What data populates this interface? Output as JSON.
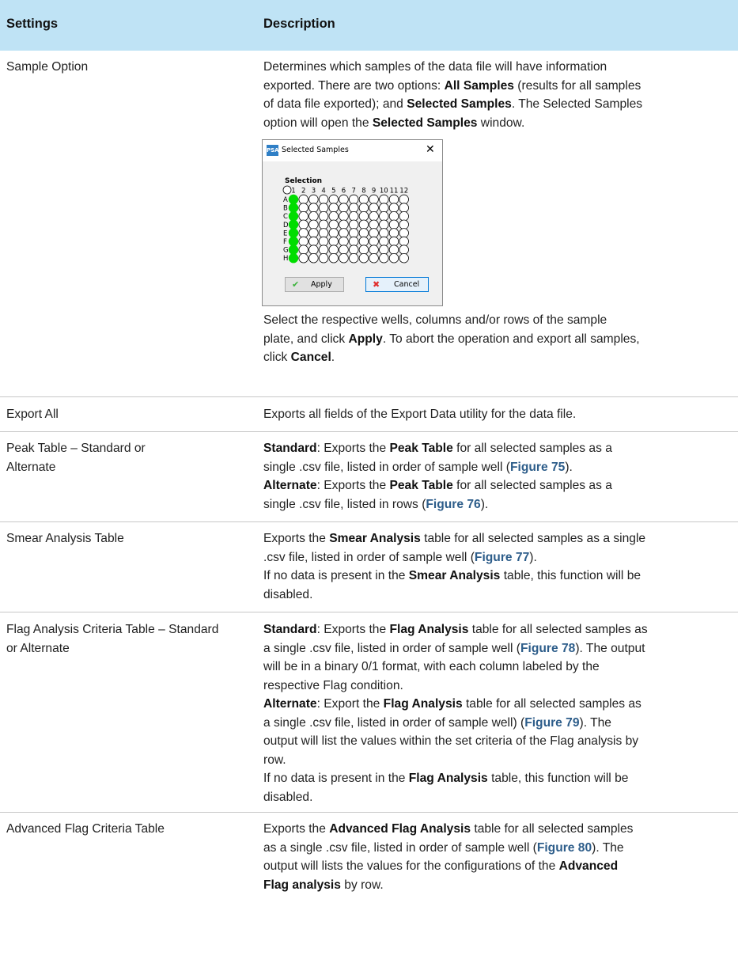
{
  "header": {
    "settings": "Settings",
    "description": "Description"
  },
  "rows": [
    {
      "setting": "Sample Option",
      "lines": [
        [
          "Determines which samples of the data file will have information"
        ],
        [
          "exported. There are two options: ",
          "<b>All Samples</b>",
          " (results for all samples"
        ],
        [
          "of data file exported); and ",
          "<b>Selected Samples</b>",
          ". The Selected Samples"
        ],
        [
          "option will open the ",
          "<b>Selected Samples</b>",
          " window."
        ]
      ],
      "after_lines": [
        [
          "Select the respective wells, columns and/or rows of the sample"
        ],
        [
          "plate, and click ",
          "<b>Apply</b>",
          ". To abort the operation and export all samples,"
        ],
        [
          "click ",
          "<b>Cancel</b>",
          "."
        ]
      ]
    },
    {
      "setting": "Export All",
      "lines": [
        [
          "Exports all fields of the Export Data utility for the data file."
        ]
      ]
    },
    {
      "setting": "Peak Table – Standard or Alternate",
      "lines": [
        [
          "<b>Standard</b>",
          ": Exports the ",
          "<b>Peak Table</b>",
          " for all selected samples as a"
        ],
        [
          "single .csv file, listed in order of sample well (",
          "<l>Figure 75</l>",
          ")."
        ],
        [
          "<b>Alternate</b>",
          ": Exports the ",
          "<b>Peak Table</b>",
          " for all selected samples as a"
        ],
        [
          "single .csv file, listed in rows (",
          "<l>Figure 76</l>",
          ")."
        ]
      ]
    },
    {
      "setting": "Smear Analysis Table",
      "lines": [
        [
          "Exports the ",
          "<b>Smear Analysis</b>",
          " table for all selected samples as a single"
        ],
        [
          ".csv file, listed in order of sample well (",
          "<l>Figure 77</l>",
          ")."
        ],
        [
          "If no data is present in the ",
          "<b>Smear Analysis</b>",
          " table, this function will be"
        ],
        [
          "disabled."
        ]
      ]
    },
    {
      "setting": "Flag Analysis Criteria Table – Standard or Alternate",
      "lines": [
        [
          "<b>Standard</b>",
          ": Exports the ",
          "<b>Flag Analysis</b>",
          " table for all selected samples as"
        ],
        [
          "a single .csv file, listed in order of sample well (",
          "<l>Figure 78</l>",
          "). The output"
        ],
        [
          "will be in a binary 0/1 format, with each column labeled by the"
        ],
        [
          "respective Flag condition."
        ],
        [
          "<b>Alternate</b>",
          ": Export the ",
          "<b>Flag Analysis</b>",
          " table for all selected samples as"
        ],
        [
          "a single .csv file, listed in order of sample well) (",
          "<l>Figure 79</l>",
          "). The"
        ],
        [
          "output will list the values within the set criteria of the Flag analysis by"
        ],
        [
          "row."
        ],
        [
          "If no data is present in the ",
          "<b>Flag Analysis</b>",
          " table, this function will be"
        ],
        [
          "disabled."
        ]
      ]
    },
    {
      "setting": "Advanced Flag Criteria Table",
      "lines": [
        [
          "Exports the ",
          "<b>Advanced Flag Analysis</b>",
          " table for all selected samples"
        ],
        [
          "as a single .csv file, listed in order of sample well (",
          "<l>Figure 80</l>",
          "). The"
        ],
        [
          "output will lists the values for the configurations of the ",
          "<b>Advanced</b>"
        ],
        [
          "<b>Flag analysis</b>",
          " by row."
        ]
      ]
    }
  ],
  "dialog": {
    "logo": "PSA",
    "title": "Selected Samples",
    "close": "✕",
    "section": "Selection",
    "columns": [
      "1",
      "2",
      "3",
      "4",
      "5",
      "6",
      "7",
      "8",
      "9",
      "10",
      "11",
      "12"
    ],
    "rows": [
      "A",
      "B",
      "C",
      "D",
      "E",
      "F",
      "G",
      "H"
    ],
    "selected_column": "1",
    "colors": {
      "selected": "#00dd00",
      "empty": "#ffffff",
      "border": "#000000"
    },
    "apply_label": "Apply",
    "cancel_label": "Cancel",
    "apply_icon": "checkmark-icon",
    "cancel_icon": "x-icon"
  }
}
